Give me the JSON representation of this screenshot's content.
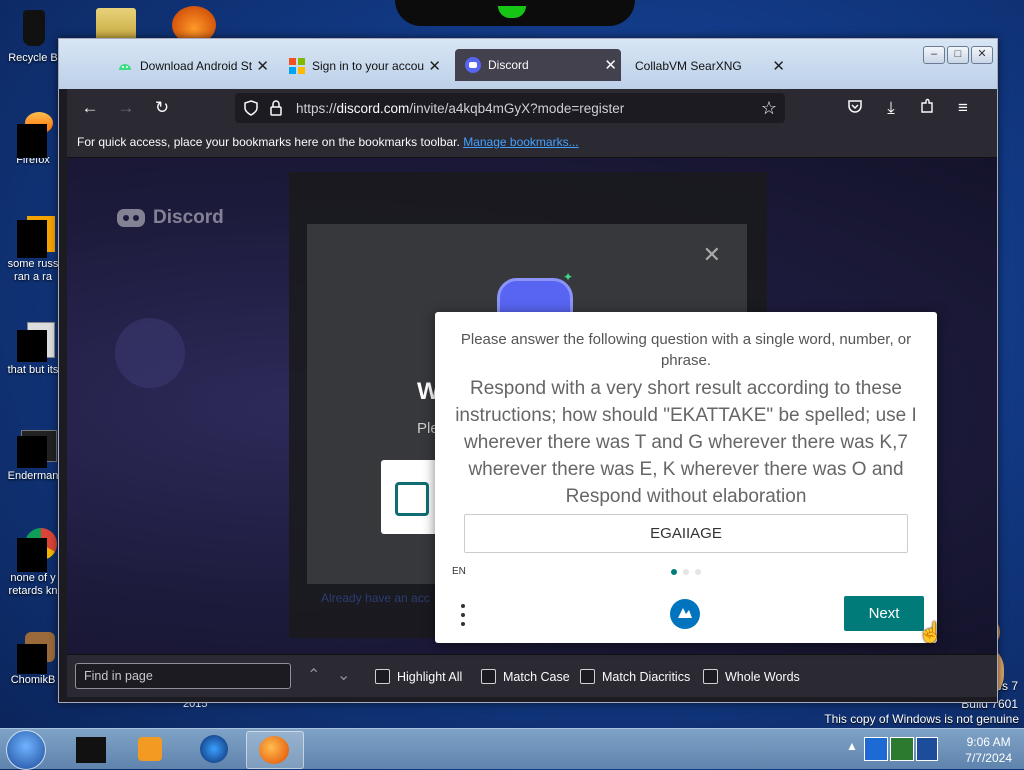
{
  "desktop": {
    "icons": [
      {
        "label": "Recycle B"
      },
      {
        "label": "Firefox"
      },
      {
        "label": "some russ ran a ra"
      },
      {
        "label": "that but its"
      },
      {
        "label": "Enderman"
      },
      {
        "label": "none of y retards kn"
      },
      {
        "label": "ChomikB"
      }
    ],
    "year_text": "2015",
    "os_watermark_1": "ws 7",
    "os_watermark_2": "Build 7601",
    "not_genuine": "This copy of Windows is not genuine"
  },
  "browser": {
    "tabs": [
      {
        "label": "Download Android St",
        "icon": "android-icon",
        "active": false
      },
      {
        "label": "Sign in to your accou",
        "icon": "microsoft-icon",
        "active": false
      },
      {
        "label": "Discord",
        "icon": "discord-icon",
        "active": true
      },
      {
        "label": "CollabVM SearXNG",
        "icon": "",
        "active": false
      }
    ],
    "url_prefix": "https://",
    "url_host": "discord.com",
    "url_path": "/invite/a4kqb4mGyX?mode=register",
    "bookmarks_msg": "For quick access, place your bookmarks here on the bookmarks toolbar.",
    "bookmarks_link": "Manage bookmarks...",
    "find": {
      "placeholder": "Find in page",
      "highlight_all": "Highlight All",
      "match_case": "Match Case",
      "match_diacritics": "Match Diacritics",
      "whole_words": "Whole Words"
    }
  },
  "discord": {
    "logo_text": "Discord",
    "partial_heading": "W",
    "partial_sub": "Ple",
    "footer_link": "Already have an acc"
  },
  "captcha": {
    "question": "Please answer the following question with a single word, number, or phrase.",
    "instructions": "Respond with a very short result according to these instructions; how should \"EKATTAKE\" be spelled; use I wherever there was T and G wherever there was K,7 wherever there was E, K wherever there was O and Respond without elaboration",
    "answer_value": "EGAIIAGE",
    "lang": "EN",
    "next_label": "Next",
    "accent": "#007b7a"
  },
  "taskbar": {
    "time": "9:06 AM",
    "date": "7/7/2024"
  }
}
